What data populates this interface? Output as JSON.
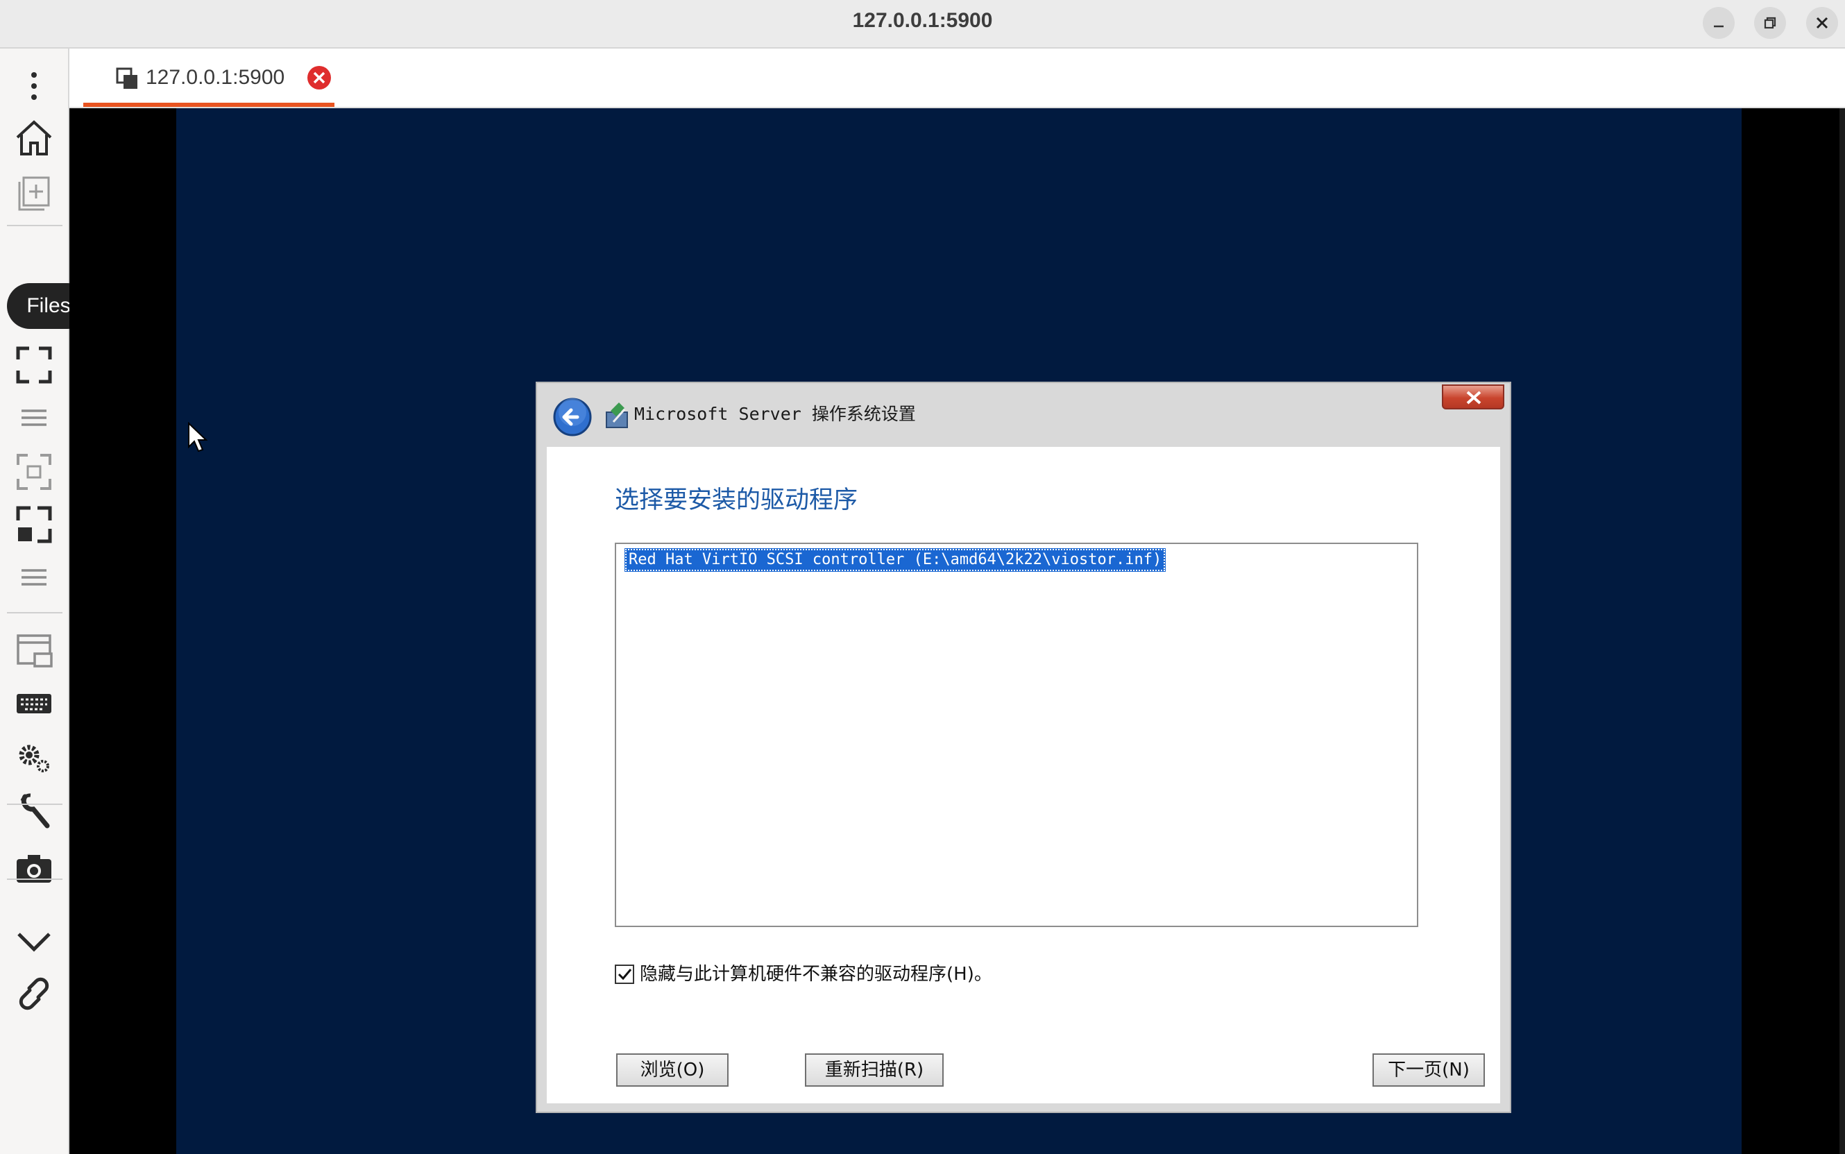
{
  "window": {
    "title": "127.0.0.1:5900"
  },
  "toolbar": {
    "tooltip": "Files",
    "items": [
      "menu-icon",
      "home-icon",
      "new-connection-icon",
      "fullscreen-icon",
      "list-icon",
      "fit-window-icon",
      "scale-icon",
      "list-icon",
      "display-icon",
      "keyboard-icon",
      "settings-icon",
      "tools-icon",
      "screenshot-icon",
      "collapse-icon",
      "disconnect-icon"
    ]
  },
  "tab": {
    "label": "127.0.0.1:5900",
    "accent_color": "#e95420"
  },
  "dialog": {
    "title": "Microsoft Server 操作系统设置",
    "heading": "选择要安装的驱动程序",
    "drivers": [
      "Red Hat VirtIO SCSI controller (E:\\amd64\\2k22\\viostor.inf)"
    ],
    "hide_incompatible_label": "隐藏与此计算机硬件不兼容的驱动程序(H)。",
    "hide_incompatible_checked": true,
    "browse_label": "浏览(O)",
    "rescan_label": "重新扫描(R)",
    "next_label": "下一页(N)",
    "heading_color": "#1d5aa7",
    "selection_color": "#1a67d2"
  },
  "remote": {
    "background_color": "#011a3f"
  }
}
